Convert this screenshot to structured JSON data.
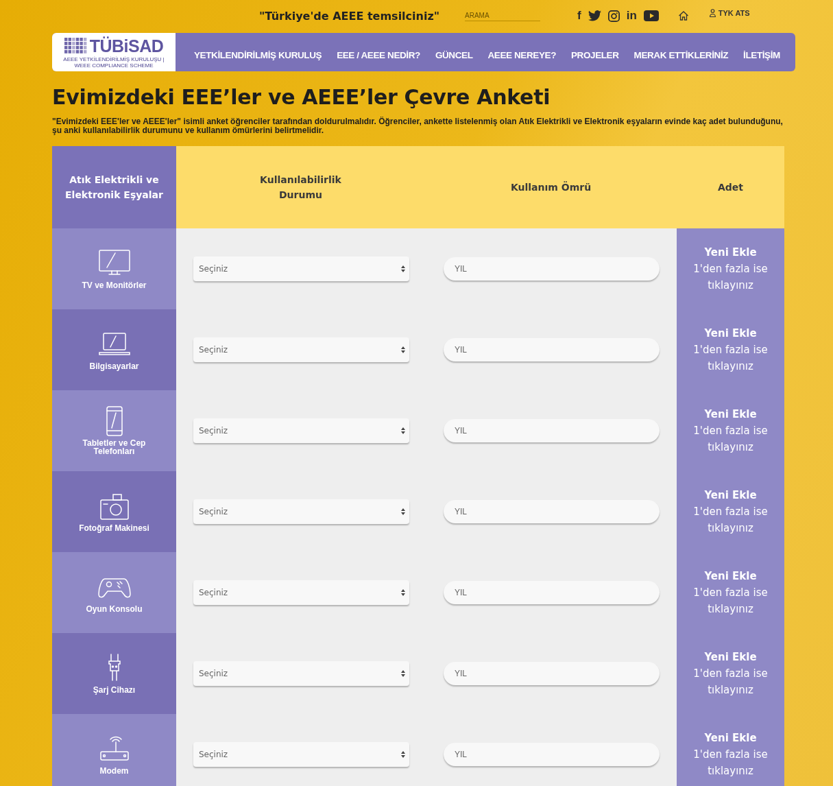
{
  "top_bar": {
    "slogan": "\"Türkiye'de AEEE temsilciniz\"",
    "search": {
      "placeholder": "ARAMA"
    },
    "social": [
      {
        "kind": "facebook",
        "label": "f"
      },
      {
        "kind": "twitter"
      },
      {
        "kind": "instagram"
      },
      {
        "kind": "linkedin",
        "label": "in"
      },
      {
        "kind": "youtube"
      }
    ],
    "user_label": "TYK ATS"
  },
  "logo": {
    "name": "TÜBiSAD",
    "subtitle": "AEEE YETKİLENDİRİLMİŞ KURULUŞU | WEEE COMPLIANCE SCHEME"
  },
  "nav": [
    "YETKİLENDİRİLMİŞ KURULUŞ",
    "EEE / AEEE NEDİR?",
    "GÜNCEL",
    "AEEE NEREYE?",
    "PROJELER",
    "MERAK ETTİKLERİNİZ",
    "İLETİŞİM"
  ],
  "title": "Evimizdeki EEE’ler ve AEEE’ler Çevre Anketi",
  "description": "\"Evimizdeki EEE'ler ve AEEE'ler\" isimli anket öğrenciler tarafından doldurulmalıdır. Öğrenciler, ankette listelenmiş olan Atık Elektrikli ve Elektronik eşyaların evinde kaç adet bulunduğunu, şu anki kullanılabilirlik durumunu ve kullanım ömürlerini belirtmelidir.",
  "table": {
    "columns": [
      "Atık Elektrikli ve Elektronik Eşyalar",
      "Kullanılabilirlik Durumu",
      "Kullanım Ömrü",
      "Adet"
    ],
    "rows": [
      {
        "kind": "tv",
        "name": "TV ve Monitörler",
        "select": "Seçiniz",
        "lifetime": {
          "placeholder": "YIL"
        },
        "add": "Yeni Ekle",
        "hint": "1'den fazla ise tıklayınız"
      },
      {
        "kind": "laptop",
        "name": "Bilgisayarlar",
        "select": "Seçiniz",
        "lifetime": {
          "placeholder": "YIL"
        },
        "add": "Yeni Ekle",
        "hint": "1'den fazla ise tıklayınız"
      },
      {
        "kind": "phone",
        "name": "Tabletler ve Cep Telefonları",
        "select": "Seçiniz",
        "lifetime": {
          "placeholder": "YIL"
        },
        "add": "Yeni Ekle",
        "hint": "1'den fazla ise tıklayınız"
      },
      {
        "kind": "camera",
        "name": "Fotoğraf Makinesi",
        "select": "Seçiniz",
        "lifetime": {
          "placeholder": "YIL"
        },
        "add": "Yeni Ekle",
        "hint": "1'den fazla ise tıklayınız"
      },
      {
        "kind": "gamepad",
        "name": "Oyun Konsolu",
        "select": "Seçiniz",
        "lifetime": {
          "placeholder": "YIL"
        },
        "add": "Yeni Ekle",
        "hint": "1'den fazla ise tıklayınız"
      },
      {
        "kind": "plug",
        "name": "Şarj Cihazı",
        "select": "Seçiniz",
        "lifetime": {
          "placeholder": "YIL"
        },
        "add": "Yeni Ekle",
        "hint": "1'den fazla ise tıklayınız"
      },
      {
        "kind": "router",
        "name": "Modem",
        "select": "Seçiniz",
        "lifetime": {
          "placeholder": "YIL"
        },
        "add": "Yeni Ekle",
        "hint": "1'den fazla ise tıklayınız"
      }
    ]
  }
}
